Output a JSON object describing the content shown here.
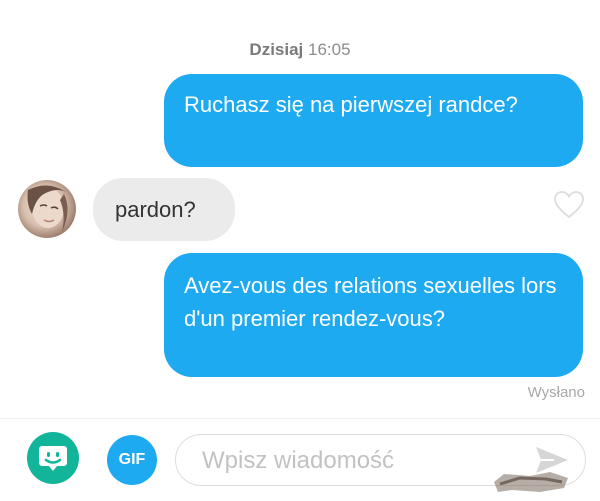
{
  "chat": {
    "date_label": "Dzisiaj",
    "time_label": "16:05",
    "messages": [
      {
        "direction": "outgoing",
        "text": "Ruchasz się na pierwszej randce?"
      },
      {
        "direction": "incoming",
        "text": "pardon?"
      },
      {
        "direction": "outgoing",
        "text": "Avez-vous des relations sexuelles lors d'un premier rendez-vous?"
      }
    ],
    "status": "Wysłano"
  },
  "composer": {
    "gif_label": "GIF",
    "placeholder": "Wpisz wiadomość"
  },
  "icons": {
    "sticker": "sticker-icon",
    "heart": "heart-icon",
    "send": "send-icon",
    "avatar": "avatar"
  },
  "colors": {
    "outgoing_bubble": "#1eaaf1",
    "incoming_bubble": "#ebebeb",
    "sticker_button": "#12b59a"
  }
}
